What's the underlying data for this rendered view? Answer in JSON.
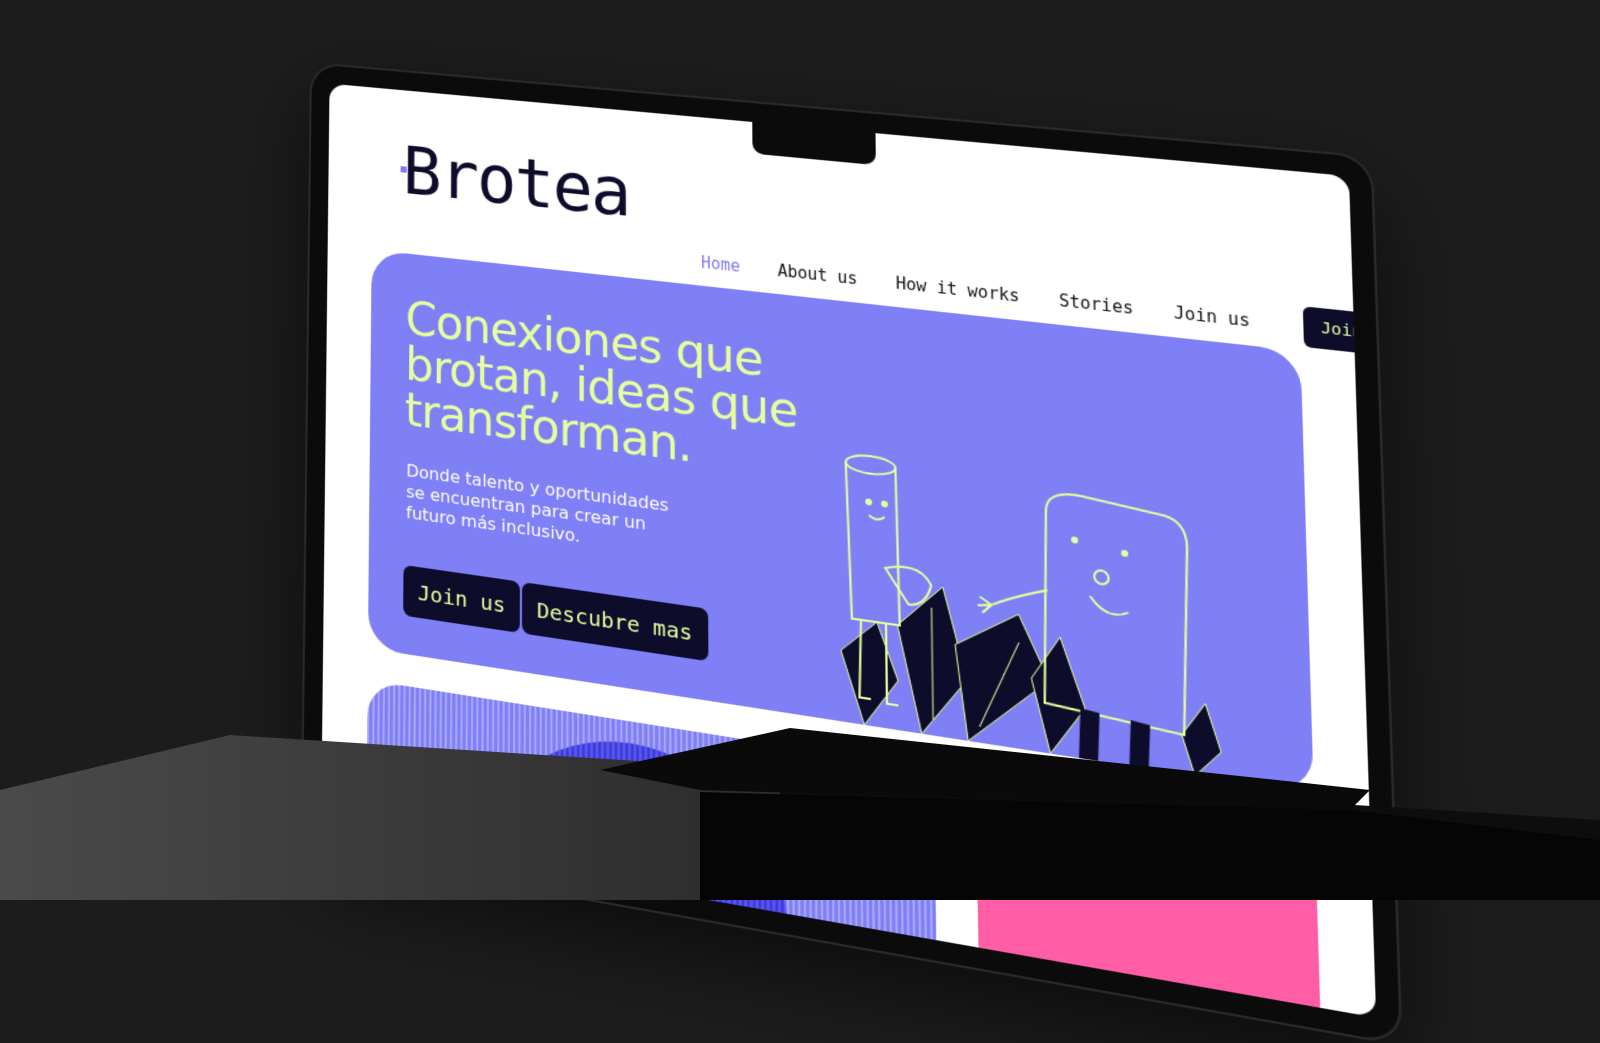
{
  "brand": {
    "logo_text": "Brotea"
  },
  "nav": {
    "items": [
      {
        "label": "Home",
        "active": true
      },
      {
        "label": "About us",
        "active": false
      },
      {
        "label": "How it works",
        "active": false
      },
      {
        "label": "Stories",
        "active": false
      },
      {
        "label": "Join us",
        "active": false
      }
    ],
    "cta_label": "Join us"
  },
  "hero": {
    "title": "Conexiones que brotan, ideas que transforman.",
    "subtitle": "Donde talento y oportunidades se encuentran para crear un futuro más inclusivo.",
    "primary_button": "Join us",
    "secondary_button": "Descubre mas"
  },
  "colors": {
    "background": "#1c1c1c",
    "hero_purple": "#7f7ff6",
    "accent_lime": "#e6ff9e",
    "dark_navy": "#0d0d2b",
    "nav_active": "#7d7cf5",
    "card_pink": "#ff5ea6"
  },
  "icons": [
    "logo-accent-dot",
    "character-illustration",
    "leaf-illustration"
  ]
}
